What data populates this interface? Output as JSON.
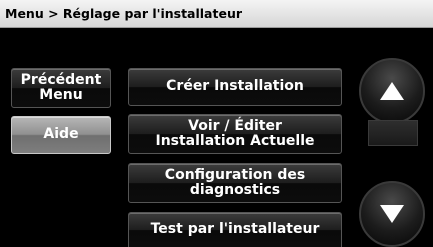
{
  "header": {
    "breadcrumb": "Menu > Réglage par l'installateur"
  },
  "left_buttons": {
    "back_line1": "Précédent",
    "back_line2": "Menu",
    "help": "Aide"
  },
  "menu_items": [
    {
      "line1": "Créer Installation"
    },
    {
      "line1": "Voir / Éditer",
      "line2": "Installation Actuelle"
    },
    {
      "line1": "Configuration des",
      "line2": "diagnostics"
    },
    {
      "line1": "Test par l'installateur"
    }
  ],
  "scroll": {
    "up_icon": "up-arrow-icon",
    "down_icon": "down-arrow-icon"
  }
}
